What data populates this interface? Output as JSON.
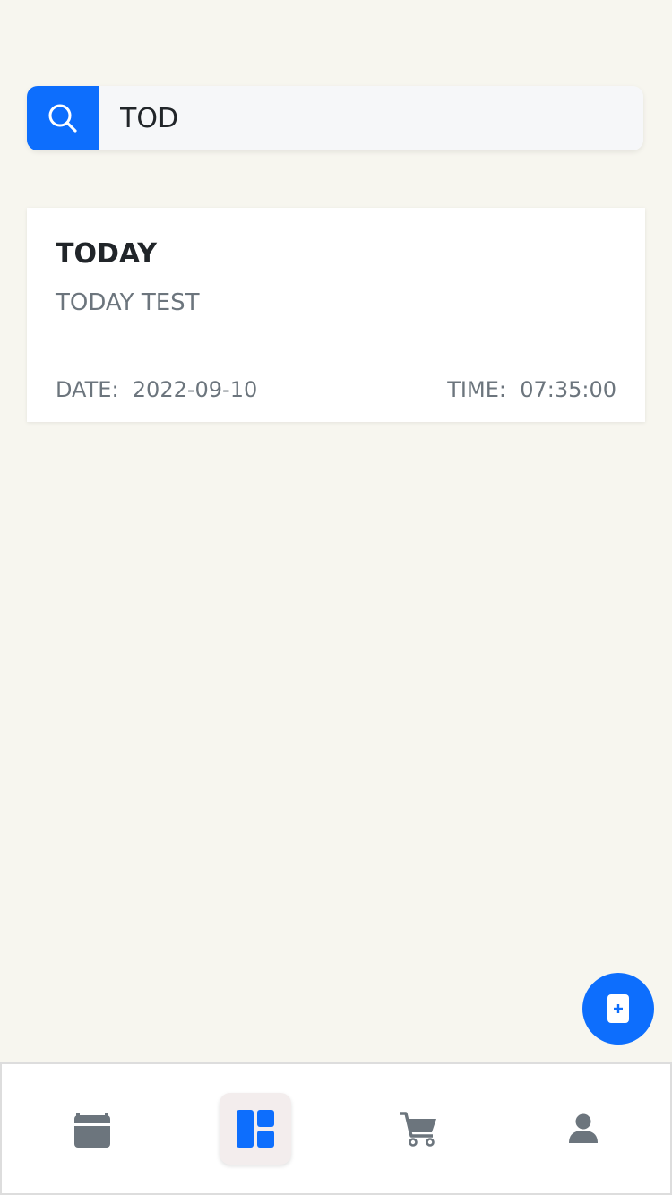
{
  "search": {
    "value": "TOD",
    "icon": "search-icon",
    "accent": "#0d6efd"
  },
  "results": [
    {
      "title": "TODAY",
      "description": "TODAY TEST",
      "date_text": "DATE:  2022-09-10",
      "time_text": "TIME:  07:35:00"
    }
  ],
  "fab": {
    "icon": "add-note-icon"
  },
  "bottom_nav": {
    "items": [
      {
        "icon": "calendar-icon",
        "active": false
      },
      {
        "icon": "dashboard-icon",
        "active": true
      },
      {
        "icon": "cart-icon",
        "active": false
      },
      {
        "icon": "user-icon",
        "active": false
      }
    ],
    "active_color": "#0d6efd",
    "inactive_color": "#6c757d"
  }
}
